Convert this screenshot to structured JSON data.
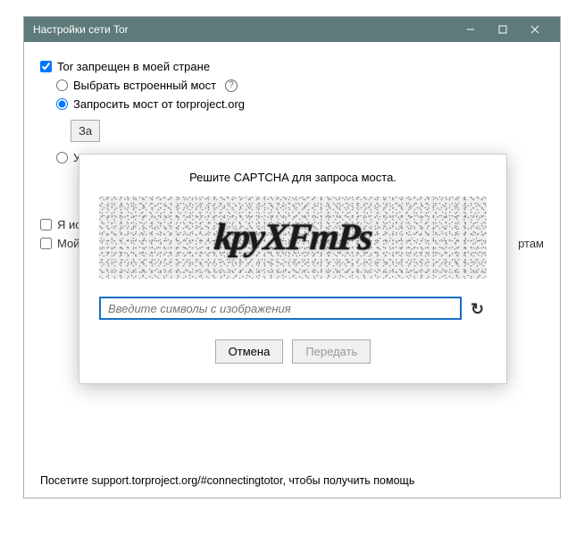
{
  "window": {
    "title": "Настройки сети Tor"
  },
  "main": {
    "checkbox_censored": "Tor запрещен в моей стране",
    "radio_builtin": "Выбрать встроенный мост",
    "radio_request": "Запросить мост от torproject.org",
    "btn_request_partial": "За",
    "radio_specify_partial": "Ука",
    "checkbox_proxy_partial": "Я ис",
    "checkbox_firewall_partial": "Мой",
    "checkbox_firewall_tail": "ртам",
    "footer": "Посетите support.torproject.org/#connectingtotor, чтобы получить помощь"
  },
  "dialog": {
    "title": "Решите CAPTCHA для запроса моста.",
    "captcha_text": "kpyXFmPs",
    "input_placeholder": "Введите символы с изображения",
    "cancel": "Отмена",
    "submit": "Передать"
  }
}
